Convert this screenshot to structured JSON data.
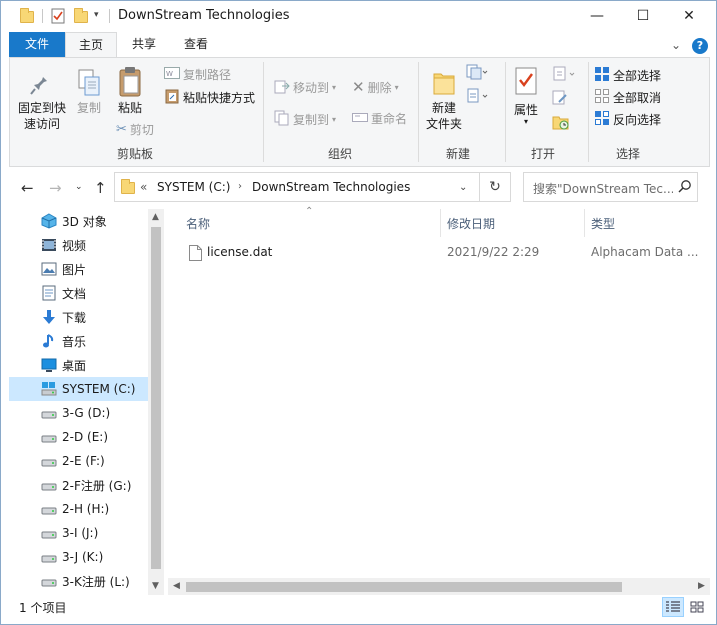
{
  "window": {
    "title": "DownStream Technologies",
    "controls": {
      "minimize": "—",
      "maximize": "☐",
      "close": "✕"
    }
  },
  "ribbon_tabs": {
    "file": "文件",
    "home": "主页",
    "share": "共享",
    "view": "查看"
  },
  "ribbon": {
    "clipboard": {
      "pin_label": "固定到快\n速访问",
      "copy_label": "复制",
      "paste_label": "粘贴",
      "copy_path": "复制路径",
      "paste_shortcut": "粘贴快捷方式",
      "cut": "剪切",
      "group": "剪贴板"
    },
    "organize": {
      "move_to": "移动到",
      "delete": "删除",
      "copy_to": "复制到",
      "rename": "重命名",
      "group": "组织"
    },
    "new": {
      "new_folder": "新建\n文件夹",
      "group": "新建"
    },
    "open": {
      "properties": "属性",
      "group": "打开"
    },
    "select": {
      "select_all": "全部选择",
      "select_none": "全部取消",
      "invert": "反向选择",
      "group": "选择"
    }
  },
  "address": {
    "overflow": "«",
    "parts": [
      "SYSTEM (C:)",
      "DownStream Technologies"
    ],
    "search_placeholder": "搜索\"DownStream Tec..."
  },
  "nav": {
    "items": [
      {
        "label": "3D 对象",
        "icon": "3d-objects-icon"
      },
      {
        "label": "视频",
        "icon": "video-icon"
      },
      {
        "label": "图片",
        "icon": "pictures-icon"
      },
      {
        "label": "文档",
        "icon": "documents-icon"
      },
      {
        "label": "下载",
        "icon": "downloads-icon"
      },
      {
        "label": "音乐",
        "icon": "music-icon"
      },
      {
        "label": "桌面",
        "icon": "desktop-icon"
      },
      {
        "label": "SYSTEM (C:)",
        "icon": "system-drive-icon",
        "selected": true
      },
      {
        "label": "3-G (D:)",
        "icon": "drive-icon"
      },
      {
        "label": "2-D (E:)",
        "icon": "drive-icon"
      },
      {
        "label": "2-E (F:)",
        "icon": "drive-icon"
      },
      {
        "label": "2-F注册 (G:)",
        "icon": "drive-icon"
      },
      {
        "label": "2-H (H:)",
        "icon": "drive-icon"
      },
      {
        "label": "3-I (J:)",
        "icon": "drive-icon"
      },
      {
        "label": "3-J (K:)",
        "icon": "drive-icon"
      },
      {
        "label": "3-K注册 (L:)",
        "icon": "drive-icon"
      }
    ]
  },
  "columns": {
    "name": "名称",
    "modified": "修改日期",
    "type": "类型"
  },
  "files": [
    {
      "name": "license.dat",
      "modified": "2021/9/22 2:29",
      "type": "Alphacam Data ..."
    }
  ],
  "status": {
    "count": "1 个项目"
  },
  "colors": {
    "accent": "#1979ca",
    "selection": "#cce8ff"
  }
}
